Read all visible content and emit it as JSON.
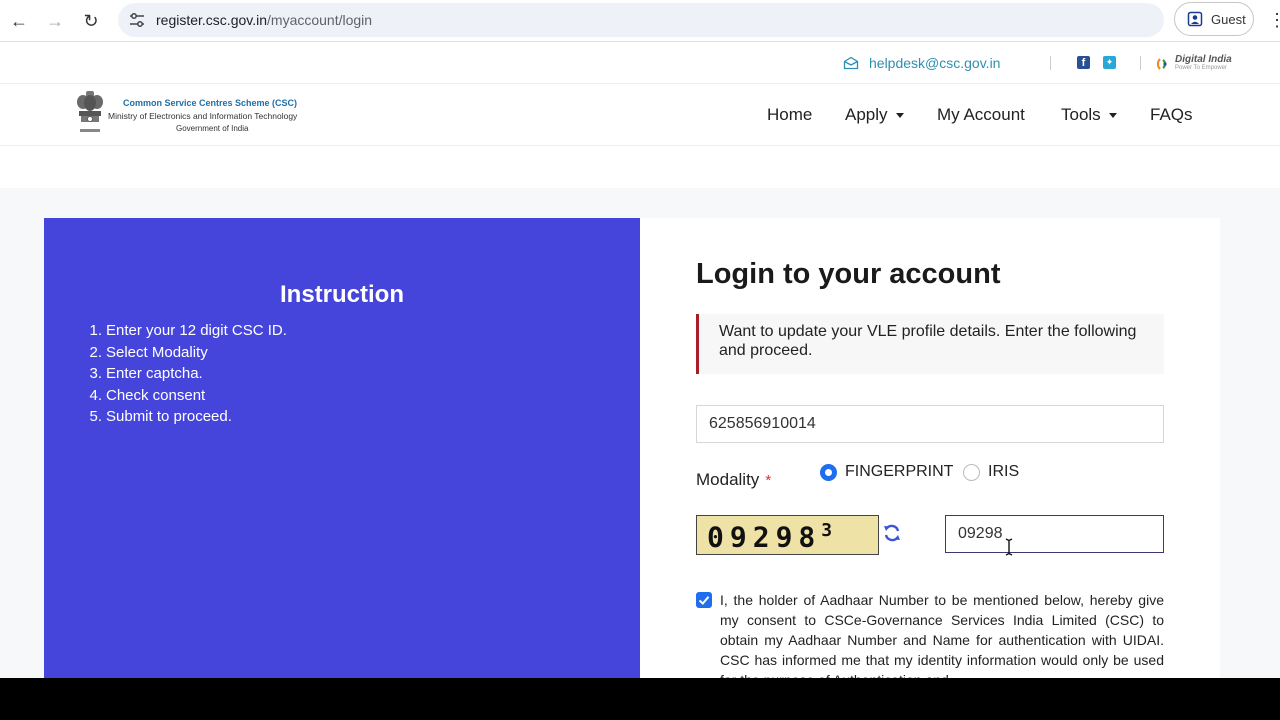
{
  "browser": {
    "url_host": "register.csc.gov.in",
    "url_path": "/myaccount/login",
    "profile_label": "Guest"
  },
  "topbar": {
    "helpdesk_email": "helpdesk@csc.gov.in",
    "digital_india": "Digital India",
    "digital_india_tagline": "Power To Empower"
  },
  "header": {
    "brand_line1": "Common Service Centres Scheme (CSC)",
    "brand_line2": "Ministry of Electronics and Information Technology",
    "brand_line3": "Government of India",
    "nav": [
      {
        "label": "Home"
      },
      {
        "label": "Apply"
      },
      {
        "label": "My Account"
      },
      {
        "label": "Tools"
      },
      {
        "label": "FAQs"
      }
    ]
  },
  "instructions": {
    "title": "Instruction",
    "items": [
      {
        "num": "1.",
        "text": "Enter your 12 digit CSC ID."
      },
      {
        "num": "2.",
        "text": "Select Modality"
      },
      {
        "num": "3.",
        "text": "Enter captcha."
      },
      {
        "num": "4.",
        "text": "Check consent"
      },
      {
        "num": "5.",
        "text": "Submit to proceed."
      }
    ]
  },
  "login": {
    "title": "Login to your account",
    "notice": "Want to update your VLE profile details. Enter the following and proceed.",
    "csc_id_value": "625856910014",
    "modality_label": "Modality",
    "required_mark": "*",
    "modality_options": [
      {
        "label": "FINGERPRINT",
        "selected": true
      },
      {
        "label": "IRIS",
        "selected": false
      }
    ],
    "captcha_image_text": "09298",
    "captcha_superscript": "3",
    "captcha_value": "09298",
    "consent_checked": true,
    "consent_text": "I, the holder of Aadhaar Number to be mentioned below, hereby give my consent to CSCe-Governance Services India Limited (CSC) to obtain my Aadhaar Number and Name for authentication with UIDAI. CSC has informed me that my identity information would only be used for the purpose of Authentication and"
  },
  "colors": {
    "instruction_panel": "#4545dc",
    "accent_blue": "#1f6ef0",
    "notice_border": "#a91c2a",
    "helpdesk_link": "#2f8fb0"
  }
}
